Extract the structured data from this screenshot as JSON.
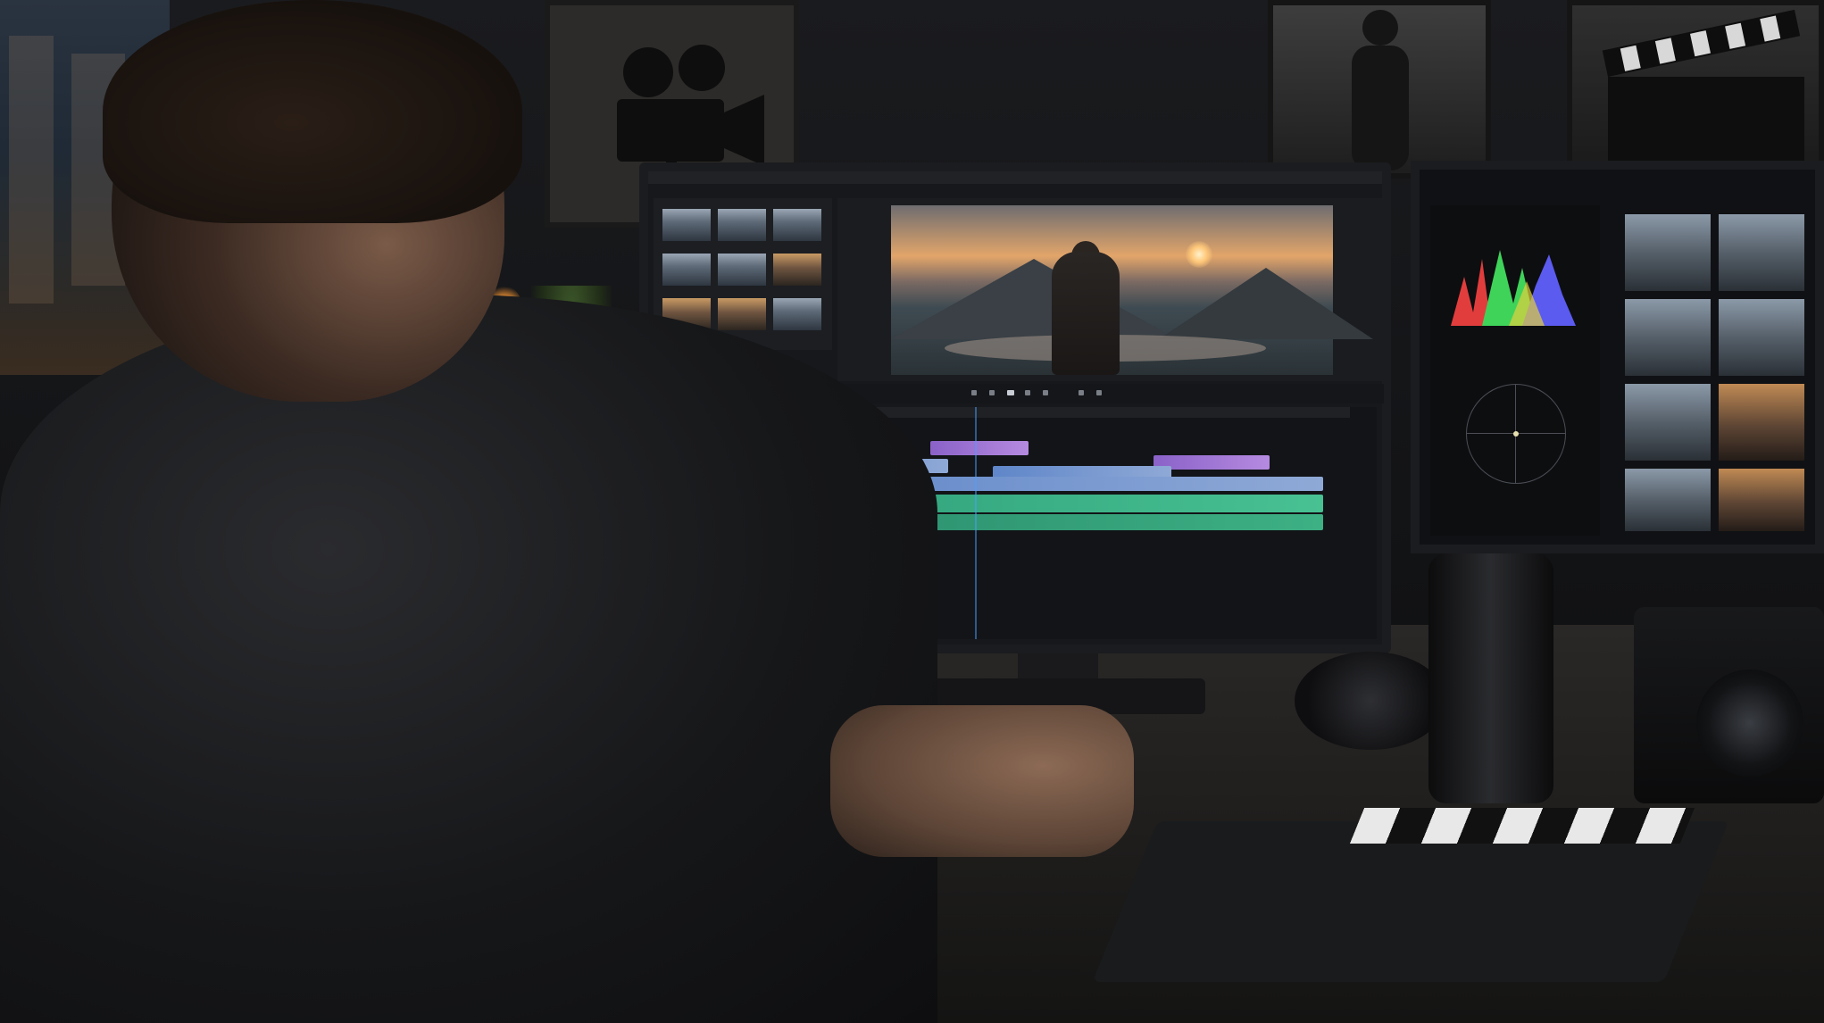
{
  "scene": {
    "subject": "person",
    "colors": {
      "timeline_video": "#6e8fd0",
      "timeline_overlay": "#a176d8",
      "timeline_audio": "#3fb487",
      "playhead": "#4aa0ff"
    }
  },
  "monitor_main": {
    "menubar_items": [
      "",
      "",
      "",
      "",
      ""
    ]
  },
  "icons": {
    "film_camera_poster": "film-camera-icon",
    "clapperboard": "clapperboard-icon"
  }
}
